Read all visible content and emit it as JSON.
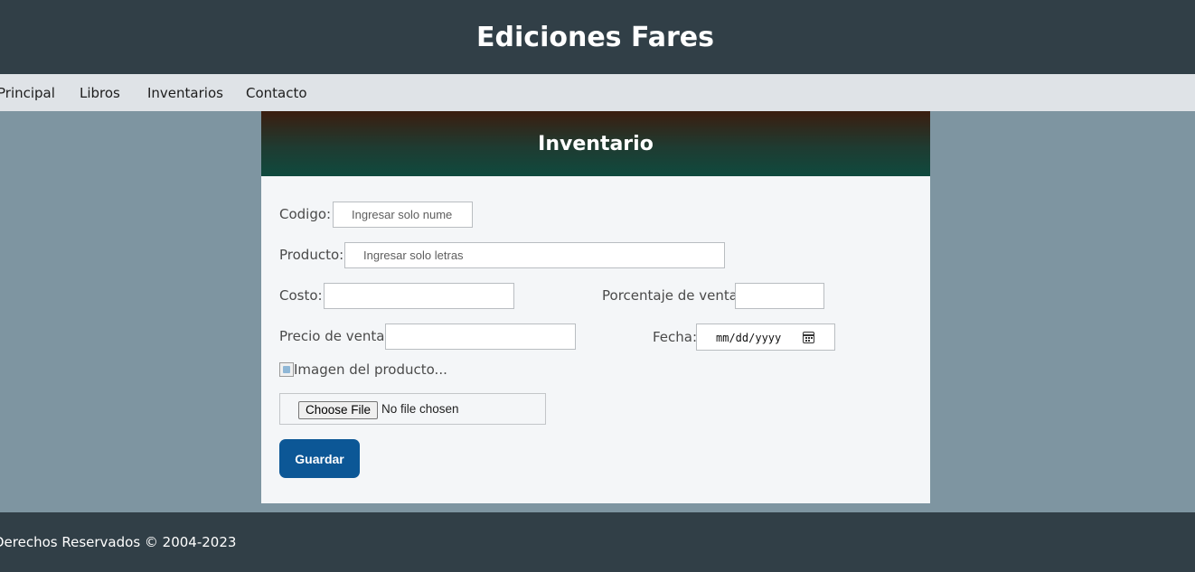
{
  "header": {
    "title": "Ediciones Fares"
  },
  "nav": {
    "items": [
      "Principal",
      "Libros",
      "Inventarios",
      "Contacto"
    ]
  },
  "card": {
    "title": "Inventario"
  },
  "form": {
    "codigo": {
      "label": "Codigo:",
      "placeholder": "Ingresar solo nume",
      "value": ""
    },
    "producto": {
      "label": "Producto:",
      "placeholder": "Ingresar solo letras",
      "value": ""
    },
    "costo": {
      "label": "Costo:",
      "value": ""
    },
    "porcentaje": {
      "label": "Porcentaje de venta:",
      "value": ""
    },
    "precio": {
      "label": "Precio de venta:",
      "value": ""
    },
    "fecha": {
      "label": "Fecha:",
      "value": "mm/dd/yyyy"
    },
    "imagen": {
      "alt": "Imagen del producto..."
    },
    "file": {
      "button_label": "Choose File",
      "status": "No file chosen"
    },
    "save_label": "Guardar"
  },
  "footer": {
    "text": "Derechos Reservados © 2004-2023"
  },
  "colors": {
    "header_bg": "#313f47",
    "nav_bg": "#dfe3e7",
    "page_bg": "#7e95a1",
    "button": "#0c5796"
  },
  "icons": {
    "date_picker": "calendar-icon",
    "product_image": "broken-image-icon"
  }
}
